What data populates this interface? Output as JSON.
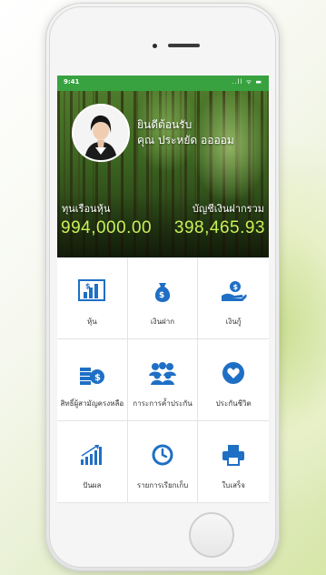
{
  "status_bar": {
    "time": "9:41",
    "icons": "..ll ᯤ ▬"
  },
  "header": {
    "greeting": "ยินดีต้อนรับ",
    "user_name": "คุณ ประหยัด  ออออม",
    "share_label": "ทุนเรือนหุ้น",
    "share_value": "994,000.00",
    "deposit_label": "บัญชีเงินฝากรวม",
    "deposit_value": "398,465.93"
  },
  "menu": [
    {
      "label": "หุ้น",
      "icon": "stock-chart-icon"
    },
    {
      "label": "เงินฝาก",
      "icon": "money-bag-icon"
    },
    {
      "label": "เงินกู้",
      "icon": "loan-hand-icon"
    },
    {
      "label": "สิทธิ์ผู้สามัญครงหลือ",
      "icon": "coins-stack-icon"
    },
    {
      "label": "การะการค้ำประกัน",
      "icon": "group-people-icon"
    },
    {
      "label": "ประกันชีวิต",
      "icon": "heart-shield-icon"
    },
    {
      "label": "ปันผล",
      "icon": "growth-chart-icon"
    },
    {
      "label": "รายการเรียกเก็บ",
      "icon": "clock-icon"
    },
    {
      "label": "ใบเสร็จ",
      "icon": "printer-icon"
    }
  ],
  "colors": {
    "brand_green": "#37a23f",
    "icon_blue": "#1f6fc5",
    "value_lime": "#c9f05a"
  }
}
